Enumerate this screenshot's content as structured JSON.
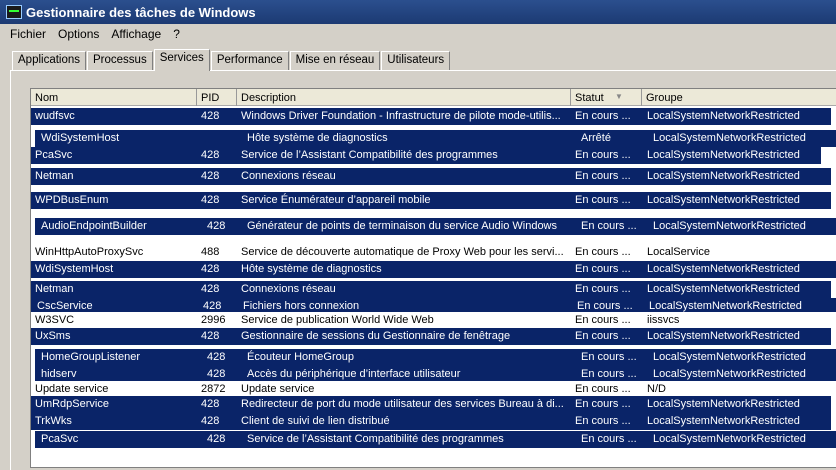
{
  "window": {
    "title": "Gestionnaire des tâches de Windows"
  },
  "menu": [
    "Fichier",
    "Options",
    "Affichage",
    "?"
  ],
  "tabs": [
    {
      "label": "Applications"
    },
    {
      "label": "Processus"
    },
    {
      "label": "Services",
      "active": true
    },
    {
      "label": "Performance"
    },
    {
      "label": "Mise en réseau"
    },
    {
      "label": "Utilisateurs"
    }
  ],
  "columns": {
    "name": "Nom",
    "pid": "PID",
    "description": "Description",
    "status": "Statut",
    "group": "Groupe",
    "sort_icon": "sort-desc-icon"
  },
  "colors": {
    "selection": "#0a2468",
    "title": "#1c3a73"
  },
  "rows": [
    {
      "name": "wudfsvc",
      "pid": "428",
      "description": "Windows Driver Foundation - Infrastructure de pilote mode-utilis...",
      "status": "En cours ...",
      "group": "LocalSystemNetworkRestricted",
      "selected": true
    },
    {
      "name": "WdiSystemHost",
      "pid": "",
      "description": "Hôte système de diagnostics",
      "status": "Arrêté",
      "group": "LocalSystemNetworkRestricted",
      "selected": true
    },
    {
      "name": "PcaSvc",
      "pid": "428",
      "description": "Service de l’Assistant Compatibilité des programmes",
      "status": "En cours ...",
      "group": "LocalSystemNetworkRestricted",
      "selected": true
    },
    {
      "name": "Netman",
      "pid": "428",
      "description": "Connexions réseau",
      "status": "En cours ...",
      "group": "LocalSystemNetworkRestricted",
      "selected": true
    },
    {
      "name": "WPDBusEnum",
      "pid": "428",
      "description": "Service Énumérateur d’appareil mobile",
      "status": "En cours ...",
      "group": "LocalSystemNetworkRestricted",
      "selected": true
    },
    {
      "name": "AudioEndpointBuilder",
      "pid": "428",
      "description": "Générateur de points de terminaison du service Audio Windows",
      "status": "En cours ...",
      "group": "LocalSystemNetworkRestricted",
      "selected": true
    },
    {
      "name": "WinHttpAutoProxySvc",
      "pid": "488",
      "description": "Service de découverte automatique de Proxy Web pour les servi...",
      "status": "En cours ...",
      "group": "LocalService",
      "selected": false
    },
    {
      "name": "WdiSystemHost",
      "pid": "428",
      "description": "Hôte système de diagnostics",
      "status": "En cours ...",
      "group": "LocalSystemNetworkRestricted",
      "selected": true
    },
    {
      "name": "Netman",
      "pid": "428",
      "description": "Connexions réseau",
      "status": "En cours ...",
      "group": "LocalSystemNetworkRestricted",
      "selected": true
    },
    {
      "name": "CscService",
      "pid": "428",
      "description": "Fichiers hors connexion",
      "status": "En cours ...",
      "group": "LocalSystemNetworkRestricted",
      "selected": true
    },
    {
      "name": "W3SVC",
      "pid": "2996",
      "description": "Service de publication World Wide Web",
      "status": "En cours ...",
      "group": "iissvcs",
      "selected": false
    },
    {
      "name": "UxSms",
      "pid": "428",
      "description": "Gestionnaire de sessions du Gestionnaire de fenêtrage",
      "status": "En cours ...",
      "group": "LocalSystemNetworkRestricted",
      "selected": true
    },
    {
      "name": "HomeGroupListener",
      "pid": "428",
      "description": "Écouteur HomeGroup",
      "status": "En cours ...",
      "group": "LocalSystemNetworkRestricted",
      "selected": true
    },
    {
      "name": "hidserv",
      "pid": "428",
      "description": "Accès du périphérique d’interface utilisateur",
      "status": "En cours ...",
      "group": "LocalSystemNetworkRestricted",
      "selected": true
    },
    {
      "name": "Update service",
      "pid": "2872",
      "description": "Update service",
      "status": "En cours ...",
      "group": "N/D",
      "selected": false
    },
    {
      "name": "UmRdpService",
      "pid": "428",
      "description": "Redirecteur de port du mode utilisateur des services Bureau à di...",
      "status": "En cours ...",
      "group": "LocalSystemNetworkRestricted",
      "selected": true
    },
    {
      "name": "TrkWks",
      "pid": "428",
      "description": "Client de suivi de lien distribué",
      "status": "En cours ...",
      "group": "LocalSystemNetworkRestricted",
      "selected": true
    },
    {
      "name": "PcaSvc",
      "pid": "428",
      "description": "Service de l’Assistant Compatibilité des programmes",
      "status": "En cours ...",
      "group": "LocalSystemNetworkRestricted",
      "selected": true
    }
  ]
}
